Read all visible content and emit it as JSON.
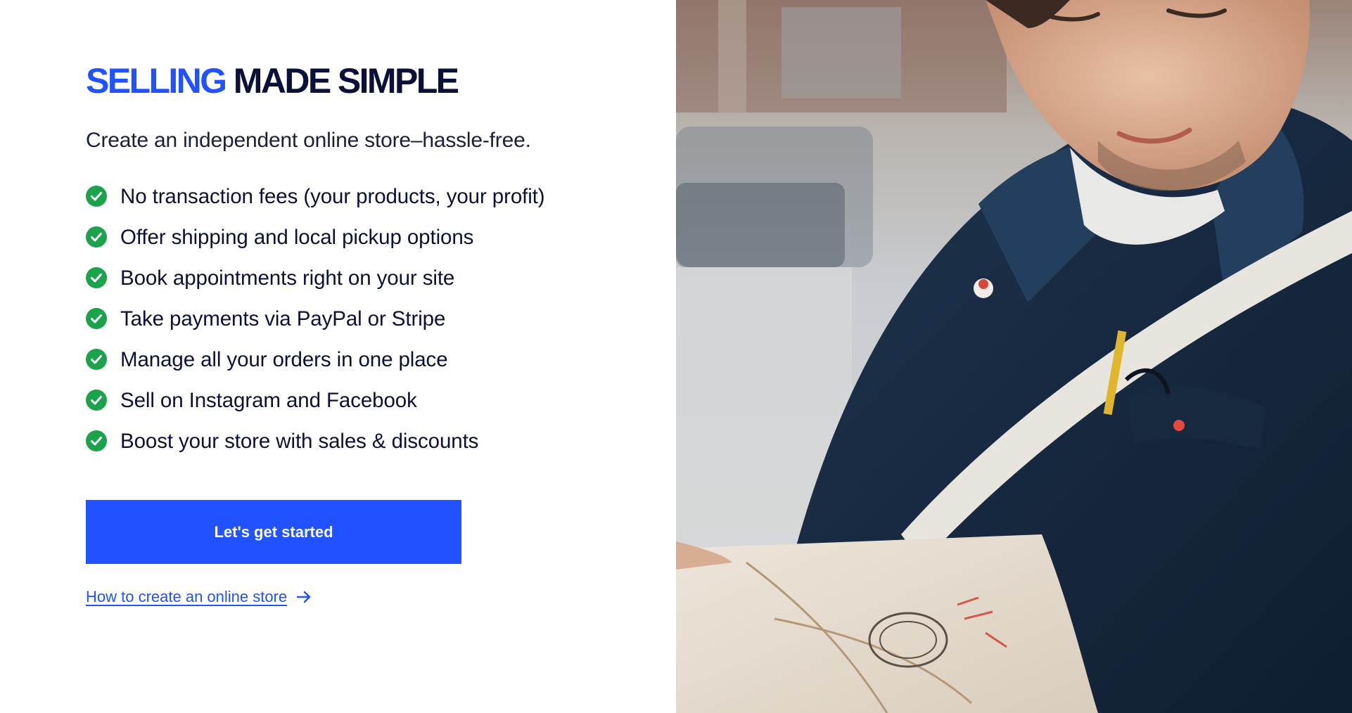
{
  "headline": {
    "accent": "SELLING",
    "rest": "MADE SIMPLE"
  },
  "subhead": "Create an independent online store–hassle-free.",
  "features": [
    "No transaction fees (your products, your profit)",
    "Offer shipping and local pickup options",
    "Book appointments right on your site",
    "Take payments via PayPal or Stripe",
    "Manage all your orders in one place",
    "Sell on Instagram and Facebook",
    "Boost your store with sales & discounts"
  ],
  "cta_label": "Let's get started",
  "link_label": "How to create an online store",
  "colors": {
    "accent": "#2152ff",
    "text": "#0b1038",
    "check": "#1aa34a"
  },
  "icons": {
    "check": "check-circle-icon",
    "arrow": "arrow-right-icon"
  }
}
